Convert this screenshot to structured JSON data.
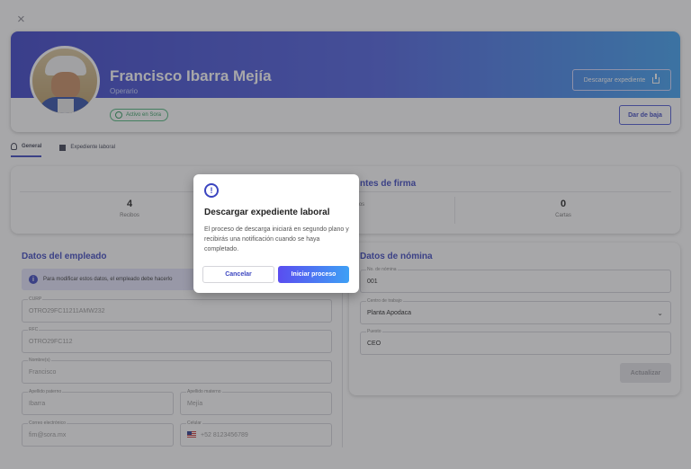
{
  "dialog": {
    "close_glyph": "×",
    "title": "Descargar expediente laboral",
    "message": "El proceso de descarga iniciará en segundo plano y recibirás una notificación cuando se haya completado.",
    "cancel_label": "Cancelar",
    "confirm_label": "Iniciar proceso"
  },
  "profile": {
    "name": "Francisco Ibarra Mejía",
    "role": "Operario",
    "status": "Activo en Sora",
    "download_label": "Descargar expediente",
    "dismiss_label": "Dar de baja"
  },
  "tabs": [
    {
      "label": "General",
      "active": true
    },
    {
      "label": "Expediente laboral",
      "active": false
    }
  ],
  "stats": {
    "firma_title": "ntes de firma",
    "items": [
      {
        "value": "4",
        "label": "Recibos"
      },
      {
        "value": "",
        "label": "os"
      },
      {
        "value": "0",
        "label": "Cartas"
      }
    ]
  },
  "employee": {
    "title": "Datos del empleado",
    "info": "Para modificar estos datos, el empleado debe hacerlo",
    "fields": {
      "curp": {
        "label": "CURP",
        "value": "OTRO29FC11211AMW232"
      },
      "rfc": {
        "label": "RFC",
        "value": "OTRO29FC112"
      },
      "nombre": {
        "label": "Nombre(s)",
        "value": "Francisco"
      },
      "apellido_paterno": {
        "label": "Apellido paterno",
        "value": "Ibarra"
      },
      "apellido_materno": {
        "label": "Apellido materno",
        "value": "Mejía"
      },
      "email": {
        "label": "Correo electrónico",
        "value": "fim@sora.mx"
      },
      "celular": {
        "label": "Celular",
        "value": "+52 8123456789"
      }
    }
  },
  "payroll": {
    "title": "Datos de nómina",
    "fields": {
      "no_nomina": {
        "label": "No. de nómina",
        "value": "001"
      },
      "centro": {
        "label": "Centro de trabajo",
        "value": "Planta Apodaca"
      },
      "puesto": {
        "label": "Puesto",
        "value": "CEO"
      }
    },
    "update_label": "Actualizar"
  },
  "colors": {
    "accent": "#3b45c0",
    "banner_start": "#3a41c8",
    "banner_end": "#3da0f2",
    "success": "#2c9b5c"
  }
}
